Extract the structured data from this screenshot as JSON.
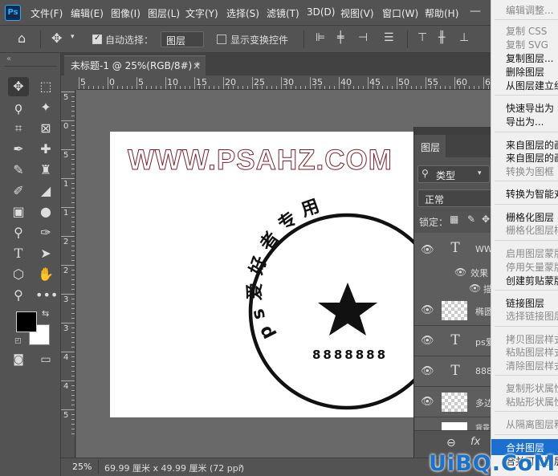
{
  "app_logo": "Ps",
  "menubar": {
    "items": [
      "文件(F)",
      "编辑(E)",
      "图像(I)",
      "图层(L)",
      "文字(Y)",
      "选择(S)",
      "滤镜(T)",
      "3D(D)",
      "视图(V)",
      "窗口(W)",
      "帮助(H)"
    ]
  },
  "options": {
    "auto_select_label": "自动选择：",
    "auto_select_value": "图层",
    "show_transform_label": "显示变换控件"
  },
  "document": {
    "tab_title": "未标题-1 @ 25%(RGB/8#) *",
    "tab_close": "×",
    "hruler_ticks": [
      "5",
      "0",
      "5",
      "10",
      "15",
      "20",
      "25",
      "30",
      "35",
      "40",
      "45",
      "50",
      "55",
      "60",
      "65"
    ],
    "vruler_ticks": [
      "5",
      "0",
      "5",
      "1",
      "1",
      "2",
      "2",
      "3",
      "3",
      "4",
      "4",
      "5"
    ]
  },
  "artwork": {
    "watermark_text": "WWW.PSAHZ.COM",
    "stamp_arc_text": "ps爱好者专用",
    "stamp_number": "8888888",
    "stamp_colors": {
      "ink": "#111111",
      "outline": "#7a1f2a"
    }
  },
  "status": {
    "zoom": "25%",
    "doc_info": "69.99 厘米 x 49.99 厘米 (72 ppi)",
    "arrow": "›"
  },
  "layers_panel": {
    "tab_label": "图层",
    "filter_label": "类型",
    "blend_mode": "正常",
    "lock_label": "锁定：",
    "layers": [
      {
        "type": "text",
        "name": "WW"
      },
      {
        "type": "effect",
        "name": "效果"
      },
      {
        "type": "effect-sub",
        "name": "描"
      },
      {
        "type": "shape",
        "name": "椭圆"
      },
      {
        "type": "text",
        "name": "ps爱"
      },
      {
        "type": "text",
        "name": "888"
      },
      {
        "type": "shape",
        "name": "多边"
      },
      {
        "type": "fill",
        "name": "背景"
      }
    ],
    "footer_link": "⊖",
    "footer_fx": "fx"
  },
  "context_menu": {
    "items": [
      {
        "label": "编辑调整...",
        "enabled": false
      },
      {
        "label": "复制 CSS",
        "enabled": false
      },
      {
        "label": "复制 SVG",
        "enabled": false
      },
      {
        "label": "复制图层...",
        "enabled": true
      },
      {
        "label": "删除图层",
        "enabled": true
      },
      {
        "label": "从图层建立组...",
        "enabled": true
      },
      {
        "label": "快速导出为 PNG",
        "enabled": true
      },
      {
        "label": "导出为...",
        "enabled": true
      },
      {
        "label": "来自图层的画板...",
        "enabled": true
      },
      {
        "label": "来自图层的画框...",
        "enabled": true
      },
      {
        "label": "转换为图框",
        "enabled": false
      },
      {
        "label": "转换为智能对象",
        "enabled": true
      },
      {
        "label": "栅格化图层",
        "enabled": true
      },
      {
        "label": "栅格化图层样式",
        "enabled": false
      },
      {
        "label": "启用图层蒙版",
        "enabled": false
      },
      {
        "label": "停用矢量蒙版",
        "enabled": false
      },
      {
        "label": "创建剪贴蒙版",
        "enabled": true
      },
      {
        "label": "链接图层",
        "enabled": true
      },
      {
        "label": "选择链接图层",
        "enabled": false
      },
      {
        "label": "拷贝图层样式",
        "enabled": false
      },
      {
        "label": "粘贴图层样式",
        "enabled": false
      },
      {
        "label": "清除图层样式",
        "enabled": false
      },
      {
        "label": "复制形状属性",
        "enabled": false
      },
      {
        "label": "粘贴形状属性",
        "enabled": false
      },
      {
        "label": "从隔离图层释放",
        "enabled": false
      },
      {
        "label": "合并图层",
        "enabled": true,
        "highlighted": true
      },
      {
        "label": "合并可见图层",
        "enabled": true
      }
    ]
  },
  "site_watermark": "UiBQ.CoM"
}
